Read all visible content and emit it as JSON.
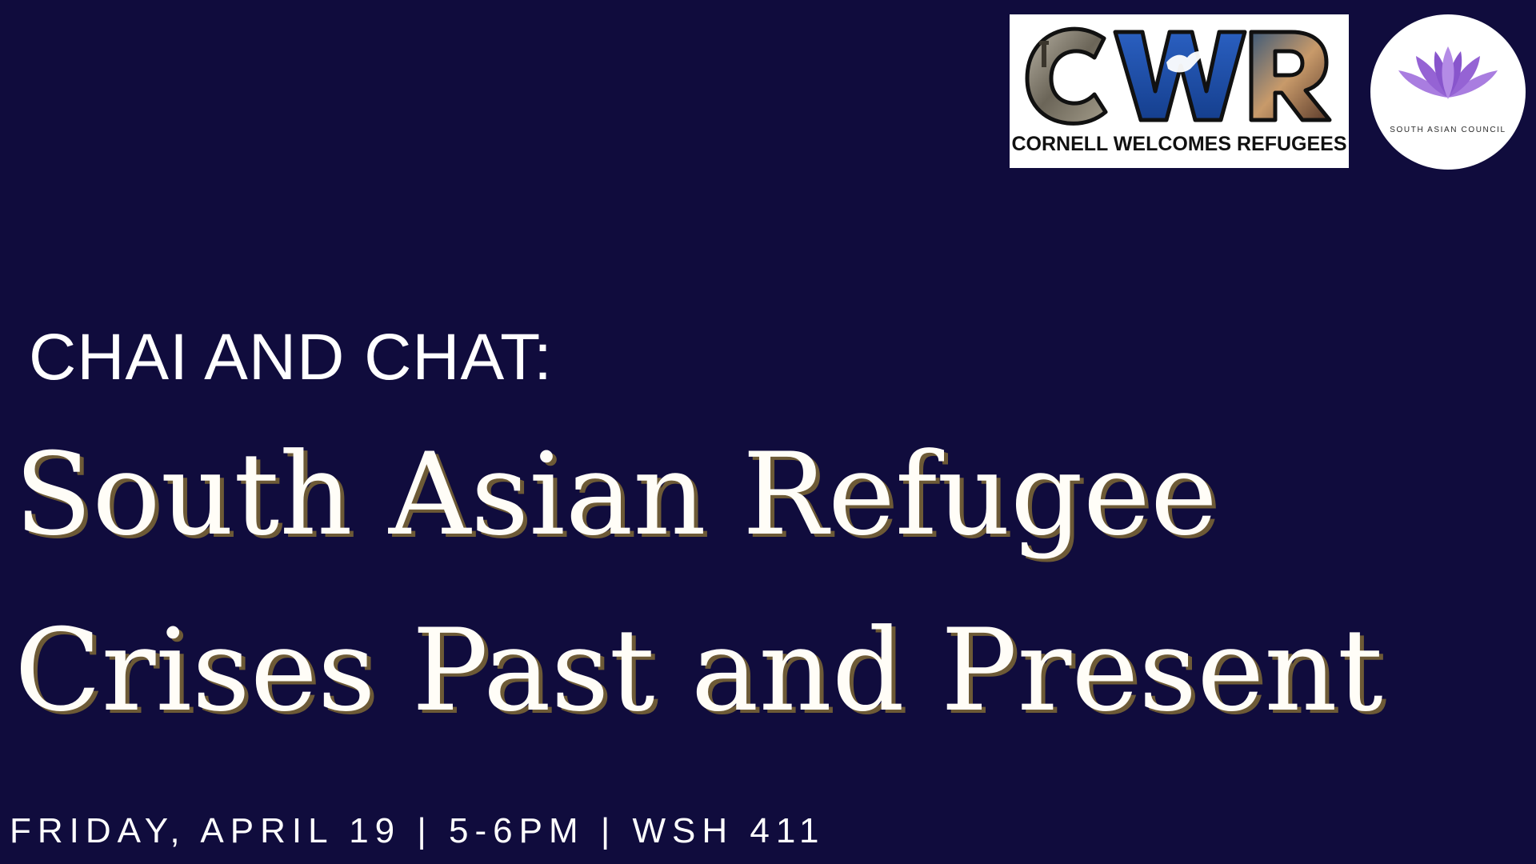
{
  "logos": {
    "cwr": {
      "letters": "CWR",
      "caption": "CORNELL WELCOMES REFUGEES"
    },
    "sac": {
      "caption": "SOUTH ASIAN COUNCIL",
      "icon": "lotus-icon"
    }
  },
  "event": {
    "eyebrow": "CHAI AND CHAT:",
    "title_line1": "South Asian Refugee",
    "title_line2": "Crises Past and Present",
    "details": "FRIDAY, APRIL 19 | 5-6PM | WSH 411"
  },
  "colors": {
    "background": "#100c3d",
    "title": "#fffdf7",
    "title_shadow": "#6d5a36",
    "text": "#ffffff",
    "cwr_blue": "#1f4fa8",
    "lotus": "#9b6bd6"
  }
}
